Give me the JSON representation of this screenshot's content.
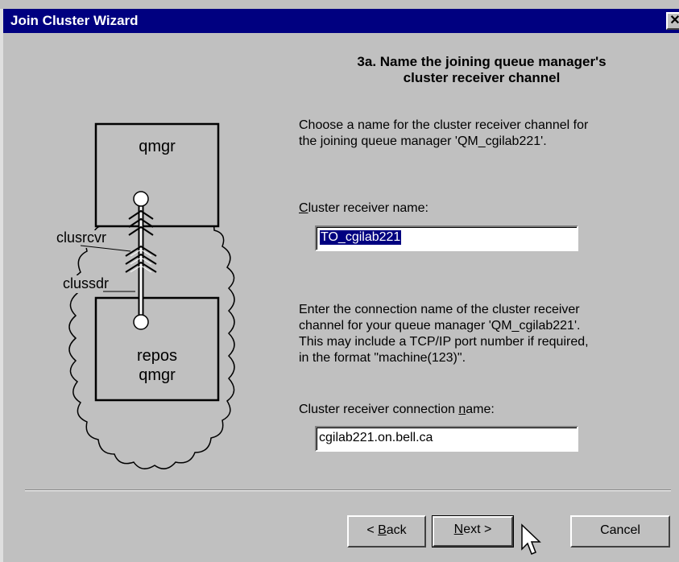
{
  "window": {
    "title": "Join Cluster Wizard",
    "close_glyph": "✕"
  },
  "diagram": {
    "top_box": "qmgr",
    "bottom_box_line1": "repos",
    "bottom_box_line2": "qmgr",
    "label_receiver": "clusrcvr",
    "label_sender": "clussdr"
  },
  "step": {
    "heading": "3a. Name the joining queue manager's\ncluster receiver channel"
  },
  "intro": {
    "text": "Choose a name for the cluster receiver channel for\nthe joining queue manager 'QM_cgilab221'."
  },
  "receiver_name": {
    "label_prefix": "",
    "label_mnemonic": "C",
    "label_rest": "luster receiver name:",
    "value": "TO_cgilab221"
  },
  "connection_help": {
    "text": "Enter the connection name of the cluster receiver\nchannel for your queue manager 'QM_cgilab221'.\nThis may include a TCP/IP port number if required,\nin the format \"machine(123)\"."
  },
  "connection_name": {
    "label_prefix": "Cluster receiver connection ",
    "label_mnemonic": "n",
    "label_rest": "ame:",
    "value": "cgilab221.on.bell.ca"
  },
  "buttons": {
    "back": {
      "prefix": "< ",
      "mnemonic": "B",
      "rest": "ack"
    },
    "next": {
      "prefix": "",
      "mnemonic": "N",
      "rest": "ext >"
    },
    "cancel": "Cancel"
  }
}
